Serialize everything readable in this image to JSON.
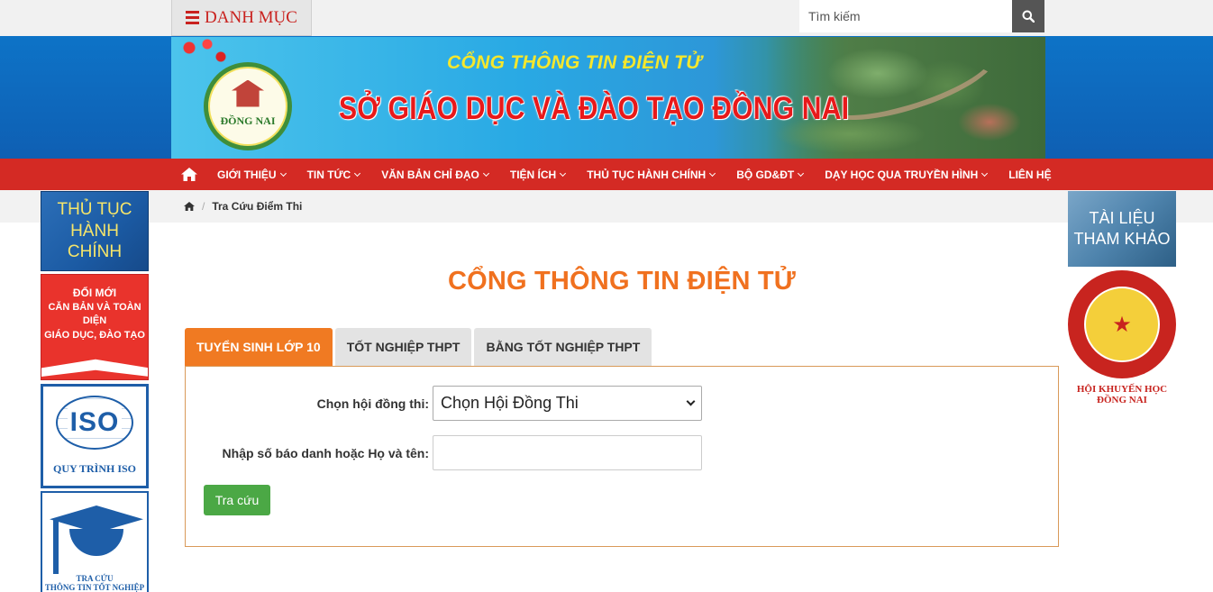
{
  "topbar": {
    "menu_label": "DANH MỤC",
    "search_placeholder": "Tìm kiếm"
  },
  "banner": {
    "subtitle": "CỔNG THÔNG TIN ĐIỆN TỬ",
    "title": "SỞ GIÁO DỤC VÀ ĐÀO TẠO ĐỒNG NAI",
    "seal_text": "ĐỒNG NAI"
  },
  "nav": {
    "items": [
      {
        "label": "GIỚI THIỆU"
      },
      {
        "label": "TIN TỨC"
      },
      {
        "label": "VĂN BẢN CHỈ ĐẠO"
      },
      {
        "label": "TIỆN ÍCH"
      },
      {
        "label": "THỦ TỤC HÀNH CHÍNH"
      },
      {
        "label": "BỘ GD&ĐT"
      },
      {
        "label": "DẠY HỌC QUA TRUYỀN HÌNH"
      },
      {
        "label": "LIÊN HỆ"
      }
    ]
  },
  "breadcrumb": {
    "current": "Tra Cứu Điểm Thi"
  },
  "left_ads": {
    "tthc": [
      "THỦ TỤC",
      "HÀNH CHÍNH"
    ],
    "doimoi": [
      "ĐỔI MỚI",
      "CĂN BẢN VÀ TOÀN DIỆN",
      "GIÁO DỤC, ĐÀO TẠO"
    ],
    "iso": {
      "word": "ISO",
      "label": "QUY TRÌNH ISO"
    },
    "tracuu": [
      "TRA CỨU",
      "THÔNG TIN TỐT NGHIỆP"
    ]
  },
  "right_ads": {
    "tailieu": [
      "TÀI LIỆU",
      "THAM KHẢO"
    ],
    "khuyenhoc": [
      "HỘI KHUYẾN HỌC",
      "ĐỒNG NAI"
    ]
  },
  "main": {
    "heading": "CỔNG THÔNG TIN ĐIỆN TỬ",
    "tabs": [
      {
        "label": "TUYỂN SINH LỚP 10",
        "active": true
      },
      {
        "label": "TỐT NGHIỆP THPT",
        "active": false
      },
      {
        "label": "BẰNG TỐT NGHIỆP THPT",
        "active": false
      }
    ],
    "form": {
      "council_label": "Chọn hội đồng thi:",
      "council_value": "Chọn Hội Đồng Thi",
      "query_label": "Nhập số báo danh hoặc Họ và tên:",
      "query_value": "",
      "submit_label": "Tra cứu"
    }
  },
  "colors": {
    "nav_red": "#d42a24",
    "accent_orange": "#f07a22",
    "submit_green": "#4ba845"
  },
  "icons": {
    "menu": "hamburger-icon",
    "search": "search-icon",
    "home": "home-icon"
  }
}
